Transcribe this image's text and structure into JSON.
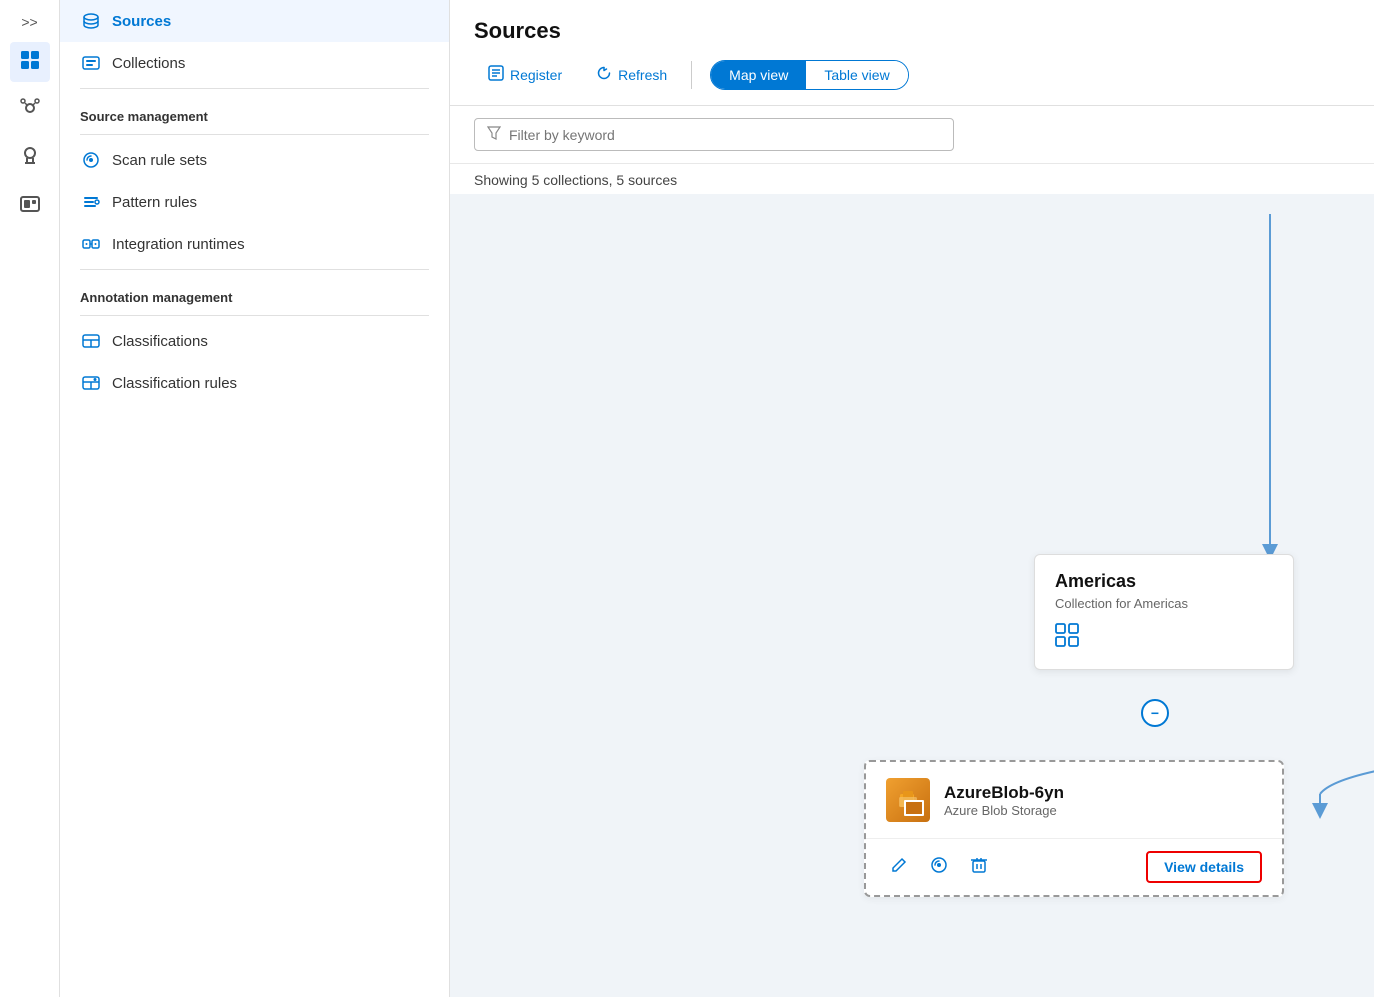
{
  "icon_sidebar": {
    "chevron_label": ">>",
    "items": [
      {
        "name": "catalog-icon",
        "icon": "🗂",
        "active": true
      },
      {
        "name": "connections-icon",
        "icon": "🔗",
        "active": false
      },
      {
        "name": "insights-icon",
        "icon": "🔑",
        "active": false
      },
      {
        "name": "tools-icon",
        "icon": "🧰",
        "active": false
      }
    ]
  },
  "nav_sidebar": {
    "sources_label": "Sources",
    "collections_label": "Collections",
    "source_management_label": "Source management",
    "scan_rule_sets_label": "Scan rule sets",
    "pattern_rules_label": "Pattern rules",
    "integration_runtimes_label": "Integration runtimes",
    "annotation_management_label": "Annotation management",
    "classifications_label": "Classifications",
    "classification_rules_label": "Classification rules"
  },
  "main": {
    "title": "Sources",
    "toolbar": {
      "register_label": "Register",
      "refresh_label": "Refresh",
      "map_view_label": "Map view",
      "table_view_label": "Table view"
    },
    "filter": {
      "placeholder": "Filter by keyword"
    },
    "showing_text": "Showing 5 collections, 5 sources"
  },
  "map": {
    "americas_card": {
      "title": "Americas",
      "subtitle": "Collection for Americas"
    },
    "source_card": {
      "name": "AzureBlob-6yn",
      "type": "Azure Blob Storage",
      "view_details_label": "View details"
    }
  }
}
